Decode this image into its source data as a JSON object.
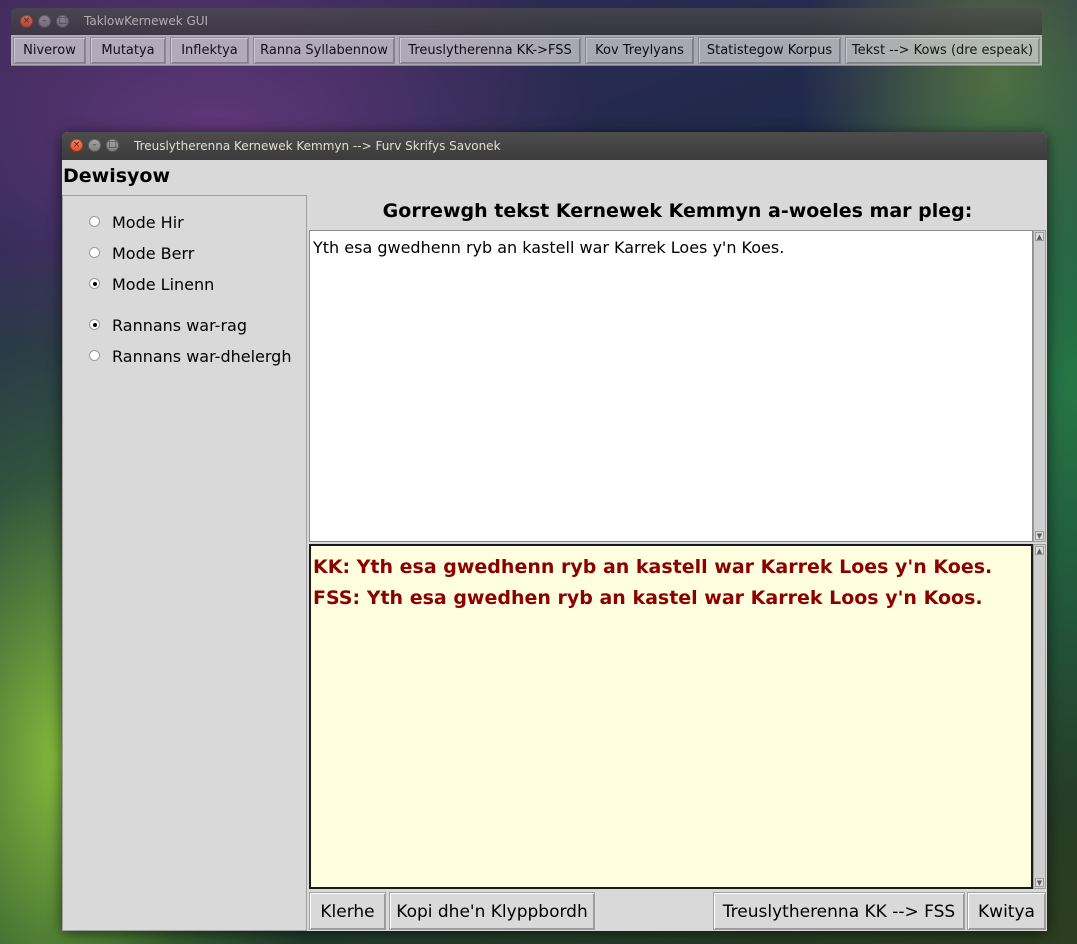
{
  "main_window": {
    "title": "TaklowKernewek GUI",
    "toolbar": [
      {
        "label": "Niverow"
      },
      {
        "label": "Mutatya"
      },
      {
        "label": "Inflektya"
      },
      {
        "label": "Ranna Syllabennow"
      },
      {
        "label": "Treuslytherenna KK->FSS"
      },
      {
        "label": "Kov Treylyans"
      },
      {
        "label": "Statistegow Korpus"
      },
      {
        "label": "Tekst --> Kows (dre espeak)"
      }
    ]
  },
  "translit_window": {
    "title": "Treuslytherenna Kernewek Kemmyn --> Furv Skrifys Savonek",
    "options_header": "Dewisyow",
    "mode_options": [
      {
        "label": "Mode Hir",
        "selected": false
      },
      {
        "label": "Mode Berr",
        "selected": false
      },
      {
        "label": "Mode Linenn",
        "selected": true
      }
    ],
    "split_options": [
      {
        "label": "Rannans war-rag",
        "selected": true
      },
      {
        "label": "Rannans war-dhelergh",
        "selected": false
      }
    ],
    "prompt": "Gorrewgh tekst Kernewek Kemmyn a-woeles mar pleg:",
    "input_text": "Yth esa gwedhenn ryb an kastell war Karrek Loes y'n Koes.",
    "output_lines": [
      "KK: Yth esa gwedhenn ryb an kastell war Karrek Loes y'n Koes.",
      "FSS: Yth esa gwedhen ryb an kastel war Karrek Loos y'n Koos."
    ],
    "buttons": {
      "clear": "Klerhe",
      "copy": "Kopi dhe'n Klyppbordh",
      "transliterate": "Treuslytherenna KK --> FSS",
      "quit": "Kwitya"
    },
    "output_color": "#8b0000",
    "output_background": "#ffffe0"
  }
}
